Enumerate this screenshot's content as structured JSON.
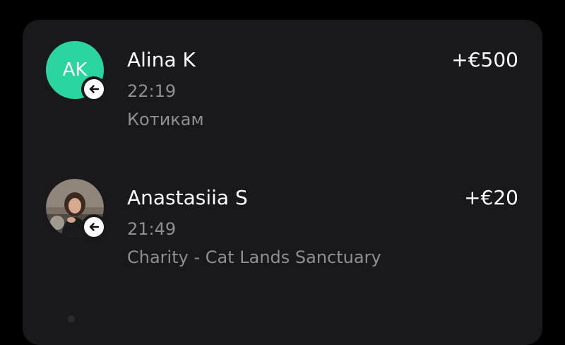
{
  "transactions": [
    {
      "avatar_initials": "AK",
      "avatar_color": "#2bd5a0",
      "direction_icon": "arrow-left-icon",
      "name": "Alina K",
      "time": "22:19",
      "description": "Котикам",
      "amount": "+€500"
    },
    {
      "avatar_type": "photo",
      "direction_icon": "arrow-left-icon",
      "name": "Anastasiia S",
      "time": "21:49",
      "description": "Charity - Cat Lands Sanctuary",
      "amount": "+€20"
    }
  ],
  "colors": {
    "background": "#000000",
    "card": "#19191b",
    "primary_text": "#ffffff",
    "secondary_text": "#8e8e93"
  }
}
